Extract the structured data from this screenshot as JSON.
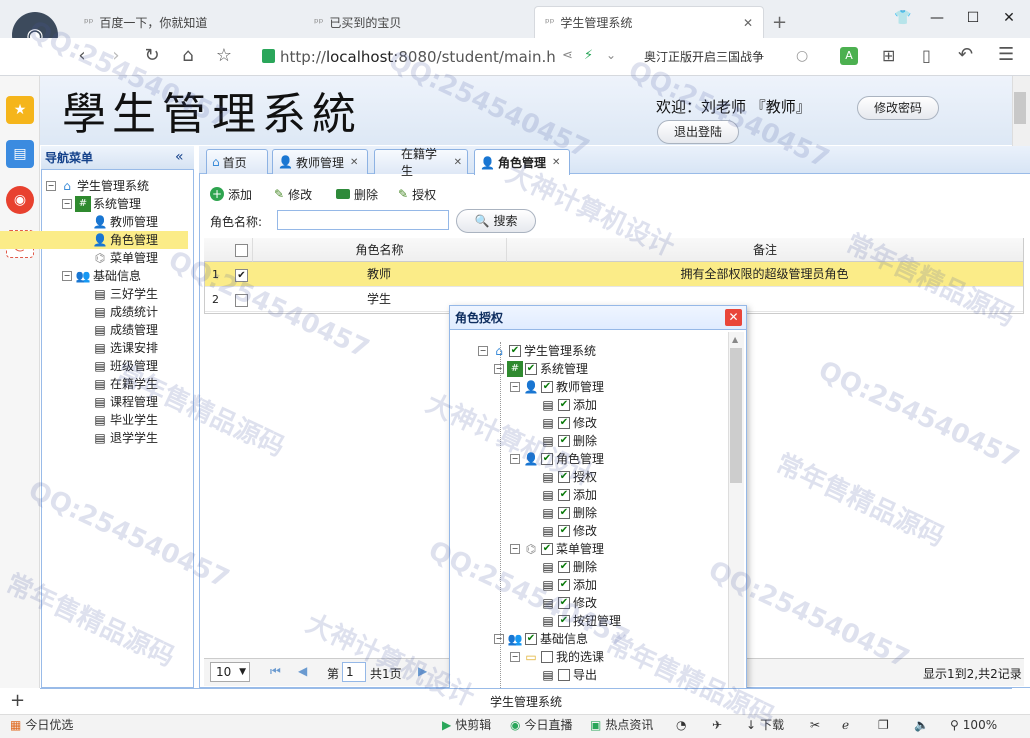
{
  "browser": {
    "tabs": [
      {
        "label": "百度一下，你就知道"
      },
      {
        "label": "已买到的宝贝"
      },
      {
        "label": "学生管理系统"
      }
    ],
    "new_tab": "+",
    "url_prefix": "http://",
    "url_host": "localhost",
    "url_rest": ":8080/student/main.h",
    "news": "奥汀正版开启三国战争",
    "zoom": "100%",
    "status": {
      "left": "今日优选",
      "items": [
        "快剪辑",
        "今日直播",
        "热点资讯",
        "下载"
      ]
    }
  },
  "app": {
    "title": "學生管理系統",
    "welcome": "欢迎：刘老师 『教师』",
    "change_password": "修改密码",
    "logout": "退出登陆",
    "footer": "学生管理系统"
  },
  "west": {
    "header": "导航菜单",
    "collapse": "«",
    "nodes": [
      {
        "label": "学生管理系统"
      },
      {
        "label": "系统管理"
      },
      {
        "label": "教师管理"
      },
      {
        "label": "角色管理"
      },
      {
        "label": "菜单管理"
      },
      {
        "label": "基础信息"
      },
      {
        "label": "三好学生"
      },
      {
        "label": "成绩统计"
      },
      {
        "label": "成绩管理"
      },
      {
        "label": "选课安排"
      },
      {
        "label": "班级管理"
      },
      {
        "label": "在籍学生"
      },
      {
        "label": "课程管理"
      },
      {
        "label": "毕业学生"
      },
      {
        "label": "退学学生"
      }
    ]
  },
  "tabs": [
    {
      "label": "首页"
    },
    {
      "label": "教师管理"
    },
    {
      "label": "在籍学生"
    },
    {
      "label": "角色管理"
    }
  ],
  "toolbar": {
    "add": "添加",
    "edit": "修改",
    "delete": "删除",
    "grant": "授权"
  },
  "search": {
    "label": "角色名称:",
    "button": "搜索"
  },
  "grid": {
    "headers": [
      "角色名称",
      "备注"
    ],
    "rows": [
      {
        "num": "1",
        "name": "教师",
        "remark": "拥有全部权限的超级管理员角色"
      },
      {
        "num": "2",
        "name": "学生",
        "remark": ""
      }
    ]
  },
  "pager": {
    "size": "10",
    "page_label": "第",
    "page": "1",
    "total": "共1页",
    "info": "显示1到2,共2记录"
  },
  "dialog": {
    "title": "角色授权",
    "nodes": [
      {
        "label": "学生管理系统"
      },
      {
        "label": "系统管理"
      },
      {
        "label": "教师管理"
      },
      {
        "label": "添加"
      },
      {
        "label": "修改"
      },
      {
        "label": "删除"
      },
      {
        "label": "角色管理"
      },
      {
        "label": "授权"
      },
      {
        "label": "添加"
      },
      {
        "label": "删除"
      },
      {
        "label": "修改"
      },
      {
        "label": "菜单管理"
      },
      {
        "label": "删除"
      },
      {
        "label": "添加"
      },
      {
        "label": "修改"
      },
      {
        "label": "按钮管理"
      },
      {
        "label": "基础信息"
      },
      {
        "label": "我的选课"
      },
      {
        "label": "导出"
      }
    ]
  },
  "watermarks": [
    "QQ:254540457",
    "大神计算机设计",
    "常年售精品源码"
  ]
}
